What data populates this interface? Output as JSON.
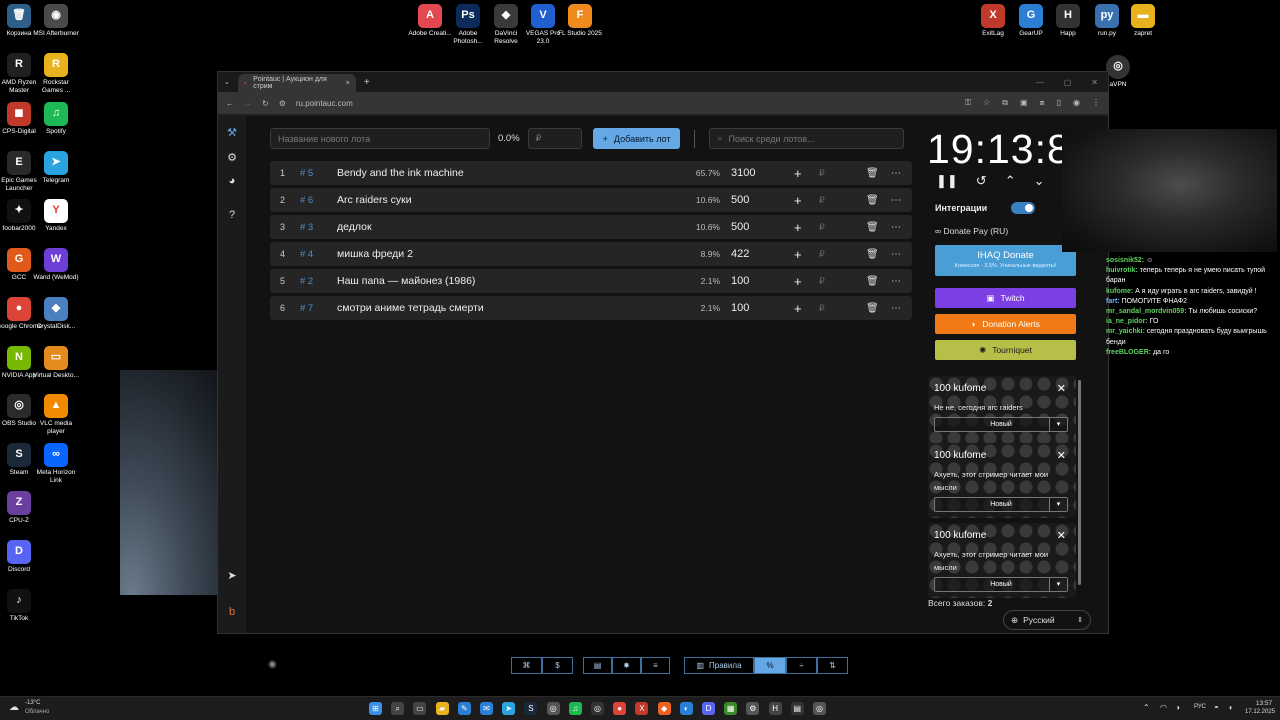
{
  "desktop": {
    "left_icons": [
      {
        "label": "Корзина",
        "glyph": "🗑",
        "color": "#2e5f8a"
      },
      {
        "label": "MSI Afterburner",
        "glyph": "◉",
        "color": "#4a4a4a"
      },
      {
        "label": "AMD Ryzen Master",
        "glyph": "R",
        "color": "#202020"
      },
      {
        "label": "Rockstar Games ...",
        "glyph": "R",
        "color": "#e8b21e"
      },
      {
        "label": "CPS-Digital",
        "glyph": "◼",
        "color": "#c0392b"
      },
      {
        "label": "Spotify",
        "glyph": "♫",
        "color": "#1db954"
      },
      {
        "label": "Epic Games Launcher",
        "glyph": "E",
        "color": "#2a2a2a"
      },
      {
        "label": "Telegram",
        "glyph": "➤",
        "color": "#2aa3df"
      },
      {
        "label": "foobar2000",
        "glyph": "✦",
        "color": "#111111"
      },
      {
        "label": "Yandex",
        "glyph": "Y",
        "color": "#ffffff"
      },
      {
        "label": "GCC",
        "glyph": "G",
        "color": "#e05a1c"
      },
      {
        "label": "Wand (WeMod)",
        "glyph": "W",
        "color": "#6d3fd8"
      },
      {
        "label": "Google Chrome",
        "glyph": "●",
        "color": "#db4437"
      },
      {
        "label": "CrystalDisk...",
        "glyph": "◆",
        "color": "#4a7fc0"
      },
      {
        "label": "NVIDIA App",
        "glyph": "N",
        "color": "#76b900"
      },
      {
        "label": "Virtual Deskto...",
        "glyph": "▭",
        "color": "#e58b1c"
      },
      {
        "label": "OBS Studio",
        "glyph": "◎",
        "color": "#2b2b2b"
      },
      {
        "label": "VLC media player",
        "glyph": "▲",
        "color": "#f08a00"
      },
      {
        "label": "Steam",
        "glyph": "S",
        "color": "#1b2838"
      },
      {
        "label": "Meta Horizon Link",
        "glyph": "∞",
        "color": "#0866ff"
      },
      {
        "label": "CPU-Z",
        "glyph": "Z",
        "color": "#6a3fa0"
      },
      {
        "label": "Discord",
        "glyph": "D",
        "color": "#5865f2"
      },
      {
        "label": "TikTok",
        "glyph": "♪",
        "color": "#111111"
      }
    ],
    "top_icons": [
      {
        "label": "Adobe Creati...",
        "glyph": "A",
        "color": "#e34850"
      },
      {
        "label": "Adobe Photosh...",
        "glyph": "Ps",
        "color": "#0c2b5a"
      },
      {
        "label": "DaVinci Resolve",
        "glyph": "◆",
        "color": "#3a3a3a"
      },
      {
        "label": "VEGAS Pro 23.0",
        "glyph": "V",
        "color": "#1f5fd0"
      },
      {
        "label": "FL Studio 2025",
        "glyph": "F",
        "color": "#f08a1c"
      }
    ],
    "right_icons": [
      {
        "label": "ExitLag",
        "glyph": "X",
        "color": "#c0392b"
      },
      {
        "label": "GearUP",
        "glyph": "G",
        "color": "#2a7fd4"
      },
      {
        "label": "Happ",
        "glyph": "H",
        "color": "#333333"
      },
      {
        "label": "run.py",
        "glyph": "py",
        "color": "#3a6fb0"
      },
      {
        "label": "zapret",
        "glyph": "▬",
        "color": "#e8b21e"
      }
    ],
    "corner_label": "aVPN"
  },
  "browser": {
    "tab_title": "Pointauc | Аукцион для стрим",
    "tab_close": "×",
    "new_tab": "+",
    "url": "ru.pointauc.com"
  },
  "app": {
    "lot_name_placeholder": "Название нового лота",
    "percent": "0.0%",
    "currency": "₽",
    "add_button": "Добавить лот",
    "search_placeholder": "Поиск среди лотов...",
    "lots": [
      {
        "idx": "1",
        "num": "# 5",
        "name": "Bendy and the ink machine",
        "pct": "65.7%",
        "amount": "3100"
      },
      {
        "idx": "2",
        "num": "# 6",
        "name": "Arc raiders суки",
        "pct": "10.6%",
        "amount": "500"
      },
      {
        "idx": "3",
        "num": "# 3",
        "name": "дедлок",
        "pct": "10.6%",
        "amount": "500"
      },
      {
        "idx": "4",
        "num": "# 4",
        "name": "мишка фреди 2",
        "pct": "8.9%",
        "amount": "422"
      },
      {
        "idx": "5",
        "num": "# 2",
        "name": "Наш папа — майонез (1986)",
        "pct": "2.1%",
        "amount": "100"
      },
      {
        "idx": "6",
        "num": "# 7",
        "name": "смотри аниме тетрадь смерти",
        "pct": "2.1%",
        "amount": "100"
      }
    ],
    "timer": "19:13:83",
    "integrations_label": "Интеграции",
    "donate_pay": "Donate Pay (RU)",
    "ihaq_title": "IHAQ Donate",
    "ihaq_sub": "Комиссия - 3,5%. Уникальные виджеты!",
    "twitch": "Twitch",
    "donation_alerts": "Donation Alerts",
    "tourniquet": "Tourniquet",
    "cards": [
      {
        "title": "100 kufome",
        "msg": "Не не, сегодня arc raiders",
        "status": "Новый"
      },
      {
        "title": "100 kufome",
        "msg": "Ахуеть, этот стример читает мои мысли",
        "status": "Новый"
      },
      {
        "title": "100 kufome",
        "msg": "Ахуеть, этот стример читает мои мысли",
        "status": "Новый"
      }
    ],
    "orders_label": "Всего заказов:",
    "orders_count": "2",
    "language": "Русский",
    "rules": "Правила"
  },
  "chat": [
    {
      "user": "sosisnik52:",
      "text": " ☺",
      "color": "#5fd35f"
    },
    {
      "user": "huivrotik:",
      "text": " теперь теперь я не умею писать тупой баран",
      "color": "#5fd35f"
    },
    {
      "user": "kufome:",
      "text": " А я иду играть в arc raiders, завидуй !",
      "color": "#5fd35f"
    },
    {
      "user": "fart:",
      "text": " ПОМОГИТЕ ФНАФ2",
      "color": "#6fb6ff"
    },
    {
      "user": "mr_sandal_mordvin059:",
      "text": " Ты любишь сосиски?",
      "color": "#5fd35f"
    },
    {
      "user": "ia_ne_pidor:",
      "text": " ГО",
      "color": "#5fd35f"
    },
    {
      "user": "mr_yaichki:",
      "text": " сегодня праздновать буду выигрышь бенди",
      "color": "#5fd35f"
    },
    {
      "user": "freeBLOGER:",
      "text": " да го",
      "color": "#5fd35f"
    }
  ],
  "taskbar": {
    "weather_temp": "-13°C",
    "weather_text": "Облачно",
    "lang": "РУС",
    "time": "13:57",
    "date": "17.12.2025"
  }
}
